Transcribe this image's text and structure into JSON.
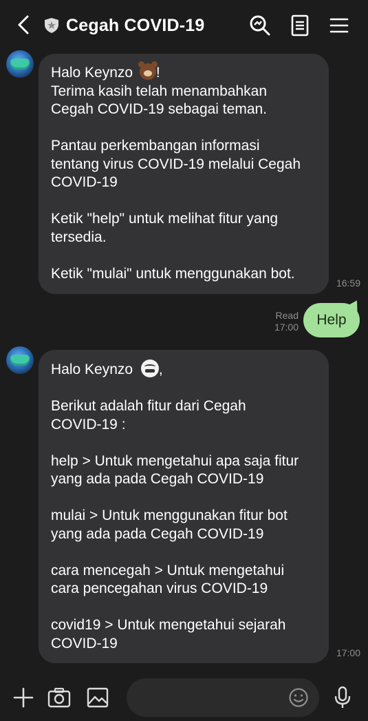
{
  "header": {
    "title": "Cegah COVID-19",
    "icons": [
      "back-icon",
      "shield-icon",
      "search-icon",
      "notes-icon",
      "menu-icon"
    ]
  },
  "messages": {
    "bot1": {
      "greeting": "Halo Keynzo",
      "greeting_suffix": "!",
      "paragraphs": [
        "Terima kasih telah menambahkan\nCegah COVID-19 sebagai teman.",
        "Pantau perkembangan informasi\ntentang virus COVID-19 melalui Cegah\nCOVID-19",
        "Ketik \"help\" untuk melihat fitur yang\ntersedia.",
        "Ketik \"mulai\" untuk menggunakan bot."
      ],
      "time": "16:59"
    },
    "user1": {
      "text": "Help",
      "status": "Read",
      "time": "17:00"
    },
    "bot2": {
      "greeting": "Halo Keynzo",
      "greeting_suffix": ",",
      "paragraphs": [
        "Berikut adalah fitur dari Cegah\nCOVID-19 :",
        "help > Untuk mengetahui apa saja fitur\nyang ada pada Cegah COVID-19",
        "mulai > Untuk menggunakan fitur bot\nyang ada pada Cegah COVID-19",
        "cara mencegah > Untuk mengetahui\ncara pencegahan virus COVID-19",
        "covid19 > Untuk mengetahui sejarah\nCOVID-19"
      ],
      "time": "17:00"
    }
  },
  "composer": {
    "placeholder": "",
    "icons": [
      "plus-icon",
      "camera-icon",
      "image-icon",
      "emoji-icon",
      "microphone-icon"
    ]
  },
  "colors": {
    "background": "#1c1c1c",
    "bot_bubble": "#333335",
    "user_bubble": "#a3e19a"
  }
}
